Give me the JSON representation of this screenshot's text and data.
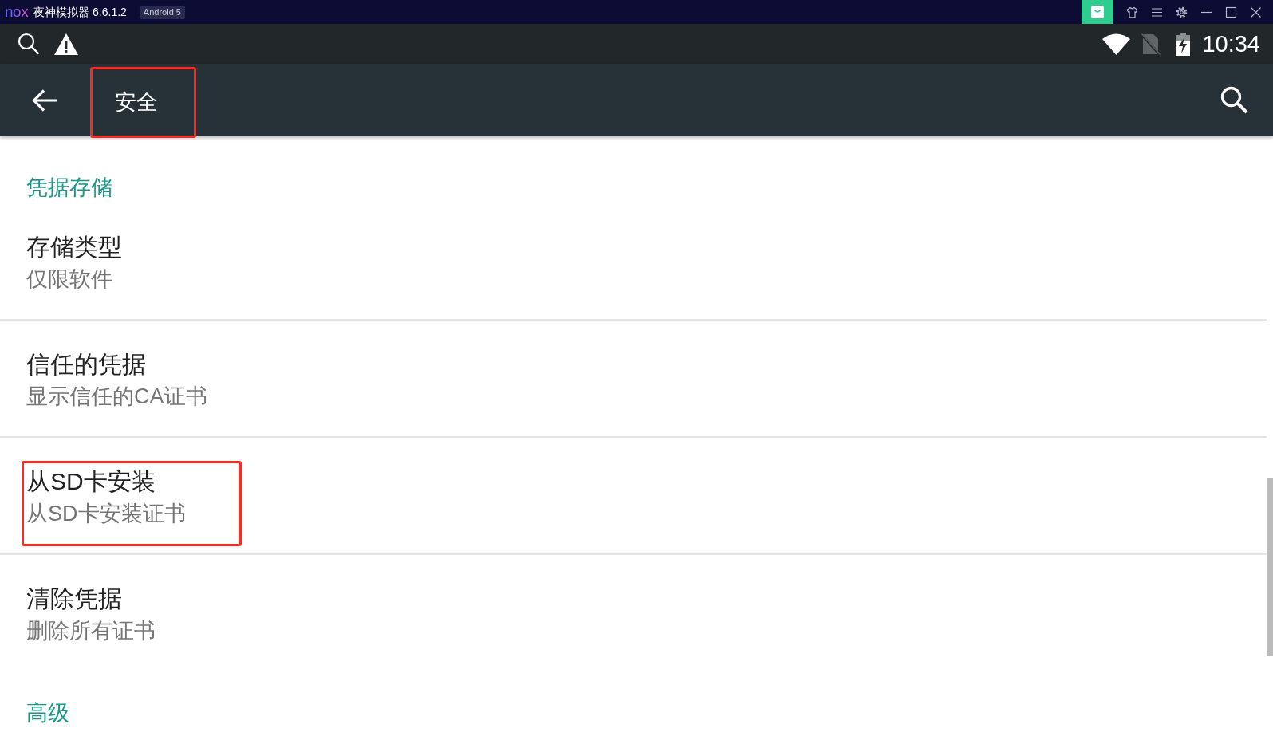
{
  "emulator_bar": {
    "logo": "nox",
    "title": "夜神模拟器 6.6.1.2",
    "badge": "Android 5"
  },
  "status_bar": {
    "time": "10:34"
  },
  "app_bar": {
    "title": "安全",
    "highlighted": true
  },
  "settings": [
    {
      "kind": "category",
      "title": "凭据存储",
      "highlighted": false
    },
    {
      "kind": "item",
      "title": "存储类型",
      "summary": "仅限软件",
      "highlighted": false
    },
    {
      "kind": "item",
      "title": "信任的凭据",
      "summary": "显示信任的CA证书",
      "highlighted": false
    },
    {
      "kind": "item",
      "title": "从SD卡安装",
      "summary": "从SD卡安装证书",
      "highlighted": true
    },
    {
      "kind": "item",
      "title": "清除凭据",
      "summary": "删除所有证书",
      "highlighted": false
    },
    {
      "kind": "category",
      "title": "高级",
      "highlighted": false
    }
  ]
}
